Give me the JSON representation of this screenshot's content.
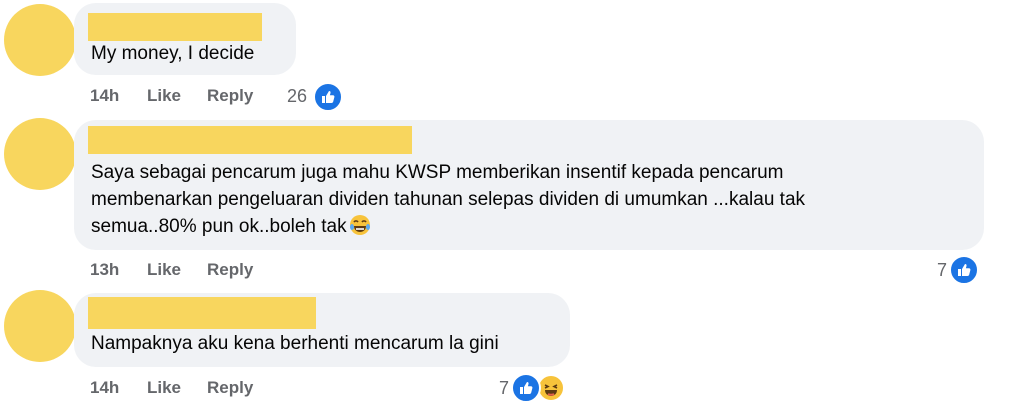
{
  "comments": [
    {
      "text_lines": [
        "My money, I decide"
      ],
      "time": "14h",
      "like_label": "Like",
      "reply_label": "Reply",
      "reactions": "26",
      "reaction_icons": [
        "like-icon"
      ]
    },
    {
      "text_lines": [
        "Saya sebagai pencarum juga mahu KWSP memberikan insentif kepada pencarum",
        "membenarkan pengeluaran dividen tahunan selepas dividen di umumkan ...kalau tak",
        "semua..80% pun ok..boleh tak"
      ],
      "time": "13h",
      "like_label": "Like",
      "reply_label": "Reply",
      "reactions": "7",
      "reaction_icons": [
        "like-icon"
      ],
      "inline_emoji": "tears-of-joy-emoji"
    },
    {
      "text_lines": [
        "Nampaknya aku kena berhenti mencarum la gini"
      ],
      "time": "14h",
      "like_label": "Like",
      "reply_label": "Reply",
      "reactions": "7",
      "reaction_icons": [
        "like-icon",
        "haha-icon"
      ]
    }
  ],
  "colors": {
    "avatar": "#f8d65e",
    "bubble": "#f0f2f5",
    "meta_text": "#65676b",
    "like_blue": "#1b74e4"
  }
}
